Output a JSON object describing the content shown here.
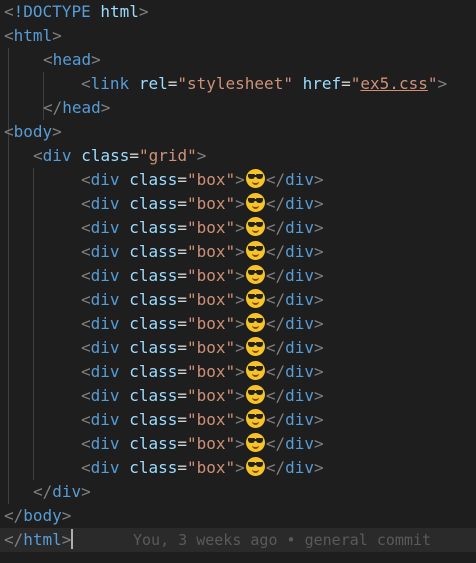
{
  "editor": {
    "lines": [
      {
        "indent": 0,
        "tokens": [
          [
            "punct",
            "<"
          ],
          [
            "tag",
            "!DOCTYPE"
          ],
          [
            "txt",
            " "
          ],
          [
            "attr",
            "html"
          ],
          [
            "punct",
            ">"
          ]
        ]
      },
      {
        "indent": 0,
        "tokens": [
          [
            "punct",
            "<"
          ],
          [
            "tag",
            "html"
          ],
          [
            "punct",
            ">"
          ]
        ]
      },
      {
        "indent": 4,
        "tokens": [
          [
            "punct",
            "<"
          ],
          [
            "tag",
            "head"
          ],
          [
            "punct",
            ">"
          ]
        ]
      },
      {
        "indent": 8,
        "tokens": [
          [
            "punct",
            "<"
          ],
          [
            "tag",
            "link"
          ],
          [
            "txt",
            " "
          ],
          [
            "attr",
            "rel"
          ],
          [
            "txt",
            "="
          ],
          [
            "str",
            "\"stylesheet\""
          ],
          [
            "txt",
            " "
          ],
          [
            "attr",
            "href"
          ],
          [
            "txt",
            "="
          ],
          [
            "str",
            "\""
          ],
          [
            "link-str",
            "ex5.css"
          ],
          [
            "str",
            "\""
          ],
          [
            "punct",
            ">"
          ]
        ]
      },
      {
        "indent": 4,
        "tokens": [
          [
            "punct",
            "</"
          ],
          [
            "tag",
            "head"
          ],
          [
            "punct",
            ">"
          ]
        ]
      },
      {
        "indent": 0,
        "tokens": [
          [
            "punct",
            "<"
          ],
          [
            "tag",
            "body"
          ],
          [
            "punct",
            ">"
          ]
        ]
      },
      {
        "indent": 3,
        "tokens": [
          [
            "punct",
            "<"
          ],
          [
            "tag",
            "div"
          ],
          [
            "txt",
            " "
          ],
          [
            "attr",
            "class"
          ],
          [
            "txt",
            "="
          ],
          [
            "str",
            "\"grid\""
          ],
          [
            "punct",
            ">"
          ]
        ]
      },
      {
        "indent": 8,
        "box": true
      },
      {
        "indent": 8,
        "box": true
      },
      {
        "indent": 8,
        "box": true
      },
      {
        "indent": 8,
        "box": true
      },
      {
        "indent": 8,
        "box": true
      },
      {
        "indent": 8,
        "box": true
      },
      {
        "indent": 8,
        "box": true
      },
      {
        "indent": 8,
        "box": true
      },
      {
        "indent": 8,
        "box": true
      },
      {
        "indent": 8,
        "box": true
      },
      {
        "indent": 8,
        "box": true
      },
      {
        "indent": 8,
        "box": true
      },
      {
        "indent": 8,
        "box": true
      },
      {
        "indent": 3,
        "tokens": [
          [
            "punct",
            "</"
          ],
          [
            "tag",
            "div"
          ],
          [
            "punct",
            ">"
          ]
        ]
      },
      {
        "indent": 0,
        "tokens": [
          [
            "punct",
            "</"
          ],
          [
            "tag",
            "body"
          ],
          [
            "punct",
            ">"
          ]
        ]
      },
      {
        "indent": 0,
        "tokens": [
          [
            "punct",
            "</"
          ],
          [
            "tag",
            "html"
          ],
          [
            "punct",
            ">"
          ]
        ],
        "cursor": true
      }
    ],
    "box_open": [
      [
        "punct",
        "<"
      ],
      [
        "tag",
        "div"
      ],
      [
        "txt",
        " "
      ],
      [
        "attr",
        "class"
      ],
      [
        "txt",
        "="
      ],
      [
        "str",
        "\"box\""
      ],
      [
        "punct",
        ">"
      ]
    ],
    "box_emoji_icon": "smiling-face-with-sunglasses-icon",
    "box_close": [
      [
        "punct",
        "</"
      ],
      [
        "tag",
        "div"
      ],
      [
        "punct",
        ">"
      ]
    ],
    "blame_text": "You, 3 weeks ago • general commit",
    "colors": {
      "background": "#1e1e1e",
      "tag": "#569cd6",
      "attribute": "#9cdcfe",
      "string": "#ce9178",
      "bracket": "#808080"
    }
  }
}
